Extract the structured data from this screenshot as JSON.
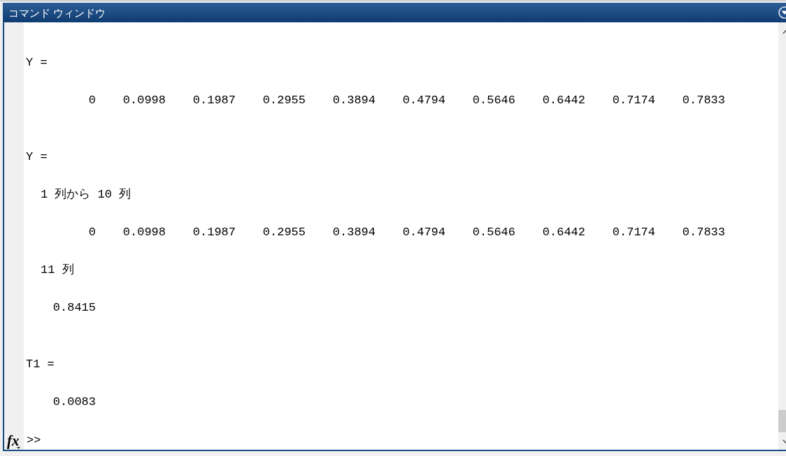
{
  "window": {
    "title": "コマンド ウィンドウ"
  },
  "output": [
    {
      "kind": "variable",
      "text": "Y ="
    },
    {
      "kind": "values",
      "values": [
        "0",
        "0.0998",
        "0.1987",
        "0.2955",
        "0.3894",
        "0.4794",
        "0.5646",
        "0.6442",
        "0.7174",
        "0.7833"
      ]
    },
    {
      "kind": "variable",
      "text": "Y ="
    },
    {
      "kind": "label",
      "text": "1 列から 10 列"
    },
    {
      "kind": "values",
      "values": [
        "0",
        "0.0998",
        "0.1987",
        "0.2955",
        "0.3894",
        "0.4794",
        "0.5646",
        "0.6442",
        "0.7174",
        "0.7833"
      ]
    },
    {
      "kind": "label",
      "text": "11 列"
    },
    {
      "kind": "values",
      "values": [
        "0.8415"
      ]
    },
    {
      "kind": "variable",
      "text": "T1 ="
    },
    {
      "kind": "values",
      "values": [
        "0.0083"
      ]
    }
  ],
  "prompt": {
    "button_label": "fx",
    "text": ">>"
  }
}
